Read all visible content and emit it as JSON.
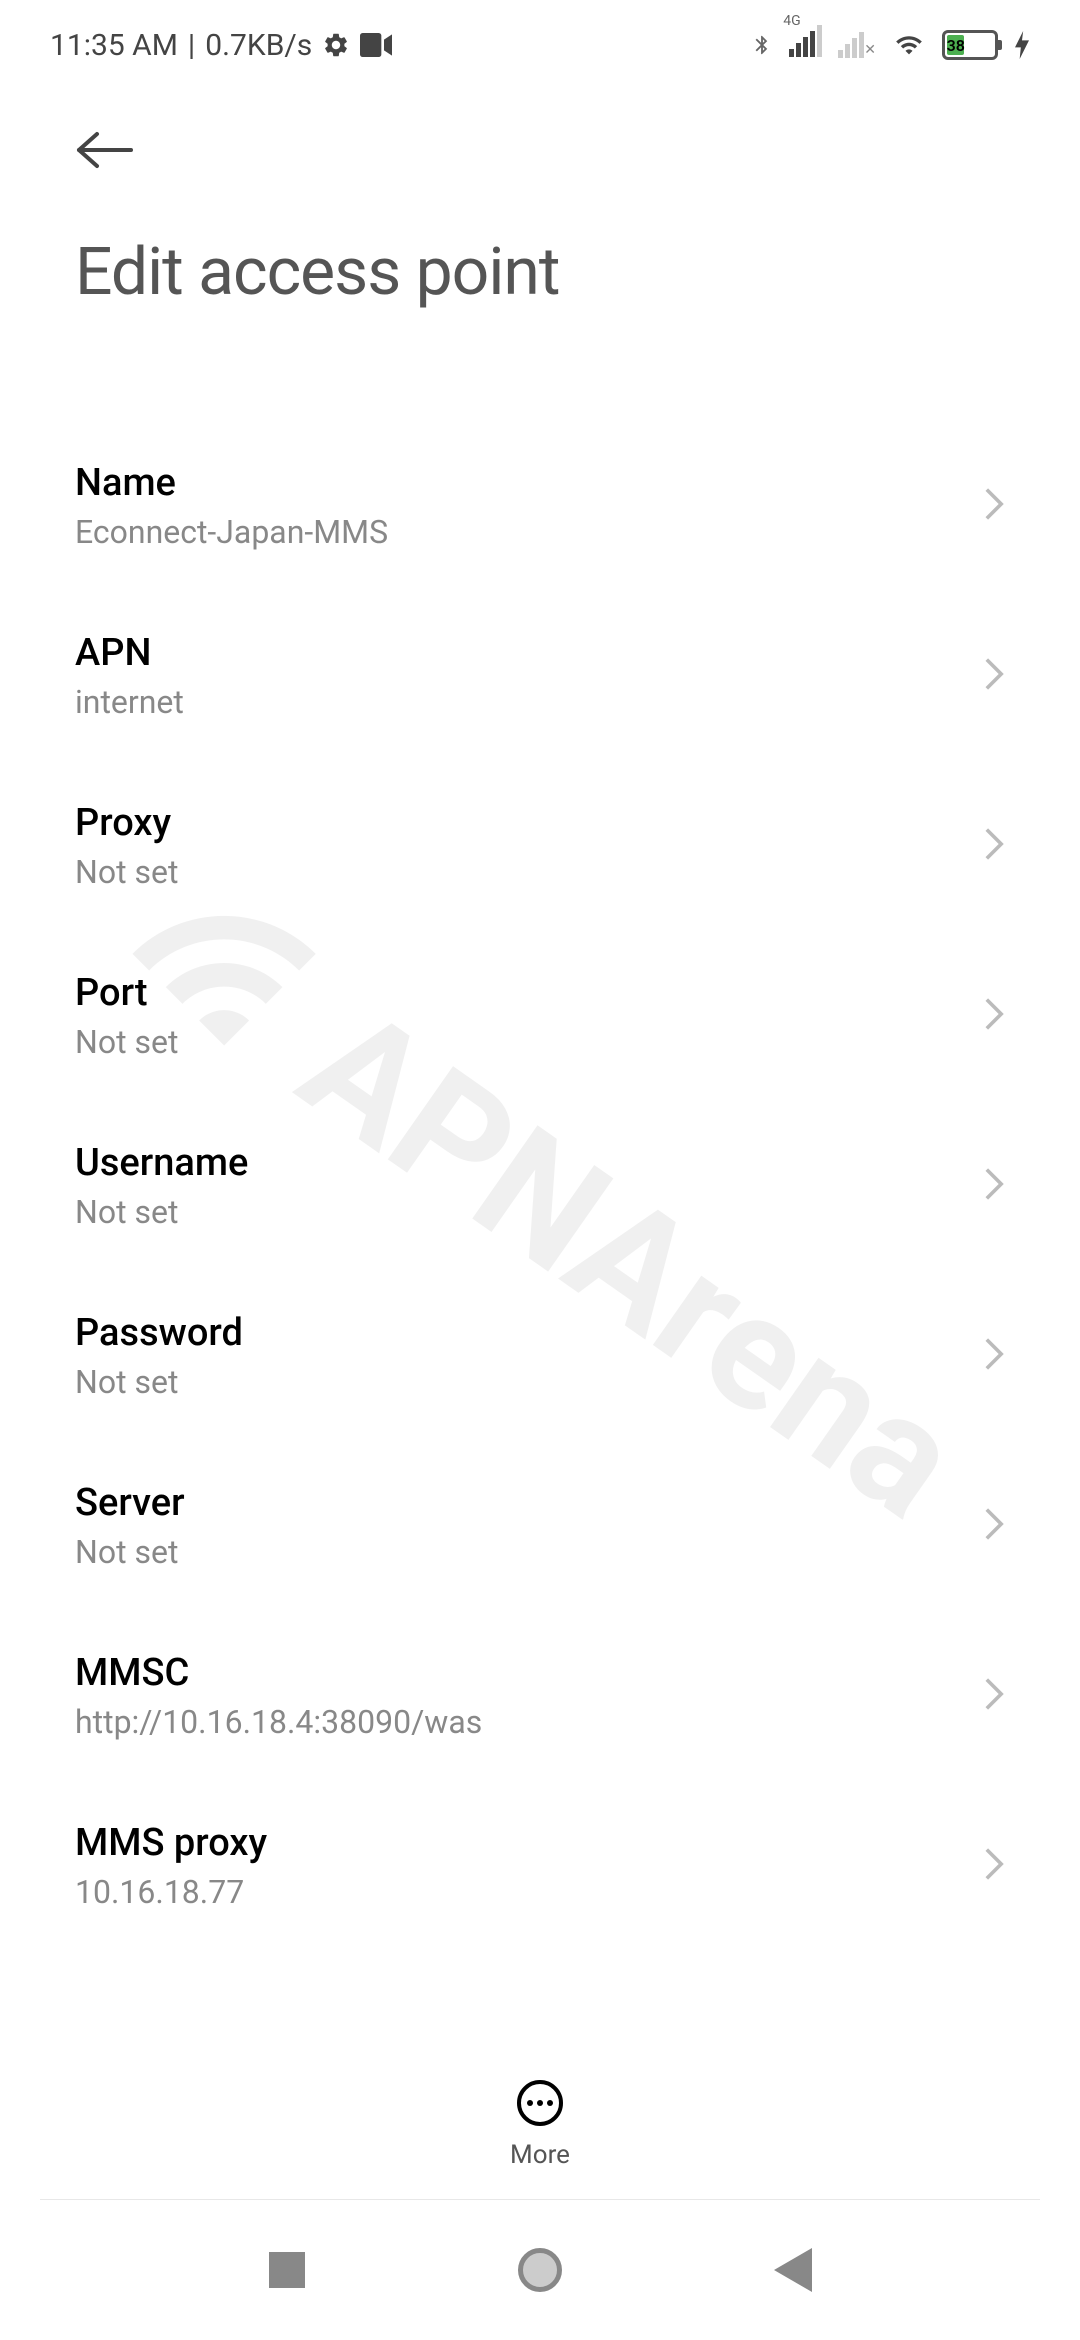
{
  "statusBar": {
    "time": "11:35 AM",
    "dataRate": "0.7KB/s",
    "networkType": "4G",
    "batteryLevel": "38"
  },
  "header": {
    "title": "Edit access point"
  },
  "settings": {
    "name": {
      "label": "Name",
      "value": "Econnect-Japan-MMS"
    },
    "apn": {
      "label": "APN",
      "value": "internet"
    },
    "proxy": {
      "label": "Proxy",
      "value": "Not set"
    },
    "port": {
      "label": "Port",
      "value": "Not set"
    },
    "username": {
      "label": "Username",
      "value": "Not set"
    },
    "password": {
      "label": "Password",
      "value": "Not set"
    },
    "server": {
      "label": "Server",
      "value": "Not set"
    },
    "mmsc": {
      "label": "MMSC",
      "value": "http://10.16.18.4:38090/was"
    },
    "mmsProxy": {
      "label": "MMS proxy",
      "value": "10.16.18.77"
    }
  },
  "actions": {
    "moreLabel": "More"
  },
  "watermark": "APNArena"
}
